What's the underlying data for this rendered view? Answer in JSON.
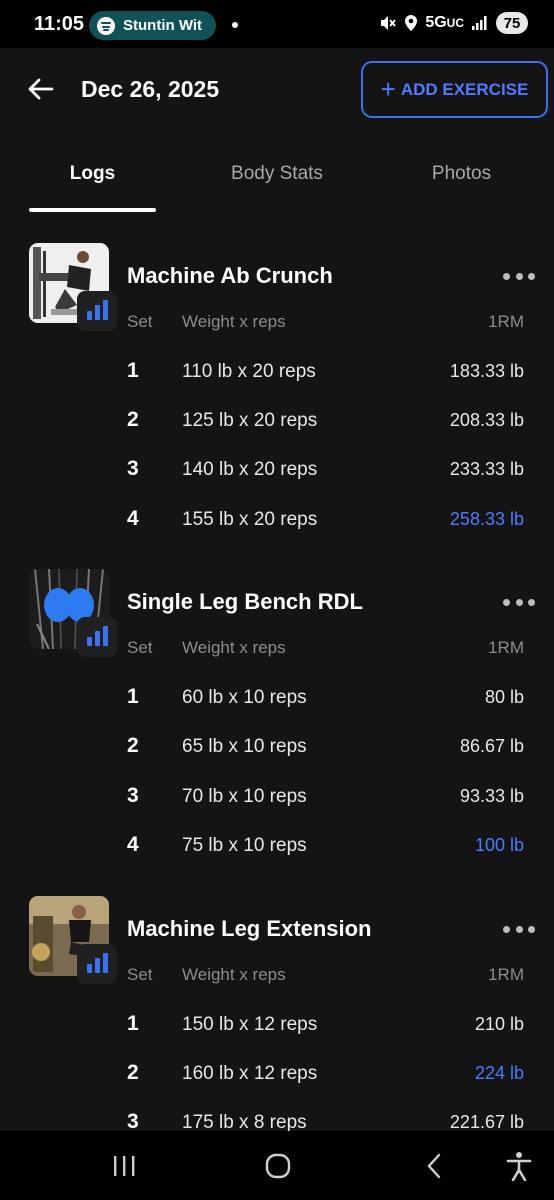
{
  "status_bar": {
    "time": "11:05",
    "media_label": "Stuntin Wit",
    "network": "5G",
    "network_suffix": "UC",
    "battery": "75"
  },
  "header": {
    "date": "Dec 26, 2025",
    "add_button_label": "ADD EXERCISE",
    "add_button_icon": "plus-icon"
  },
  "tabs": [
    {
      "label": "Logs",
      "active": true
    },
    {
      "label": "Body Stats",
      "active": false
    },
    {
      "label": "Photos",
      "active": false
    }
  ],
  "columns": {
    "set": "Set",
    "weight_reps": "Weight x reps",
    "one_rm": "1RM"
  },
  "exercises": [
    {
      "name": "Machine Ab Crunch",
      "sets": [
        {
          "set": "1",
          "weight_reps": "110 lb x 20 reps",
          "one_rm": "183.33 lb",
          "best": false
        },
        {
          "set": "2",
          "weight_reps": "125 lb x 20 reps",
          "one_rm": "208.33 lb",
          "best": false
        },
        {
          "set": "3",
          "weight_reps": "140 lb x 20 reps",
          "one_rm": "233.33 lb",
          "best": false
        },
        {
          "set": "4",
          "weight_reps": "155 lb x 20 reps",
          "one_rm": "258.33 lb",
          "best": true
        }
      ]
    },
    {
      "name": "Single Leg Bench RDL",
      "sets": [
        {
          "set": "1",
          "weight_reps": "60 lb x 10 reps",
          "one_rm": "80 lb",
          "best": false
        },
        {
          "set": "2",
          "weight_reps": "65 lb x 10 reps",
          "one_rm": "86.67 lb",
          "best": false
        },
        {
          "set": "3",
          "weight_reps": "70 lb x 10 reps",
          "one_rm": "93.33 lb",
          "best": false
        },
        {
          "set": "4",
          "weight_reps": "75 lb x 10 reps",
          "one_rm": "100 lb",
          "best": true
        }
      ]
    },
    {
      "name": "Machine Leg Extension",
      "sets": [
        {
          "set": "1",
          "weight_reps": "150 lb x 12 reps",
          "one_rm": "210 lb",
          "best": false
        },
        {
          "set": "2",
          "weight_reps": "160 lb x 12 reps",
          "one_rm": "224 lb",
          "best": true
        },
        {
          "set": "3",
          "weight_reps": "175 lb x 8 reps",
          "one_rm": "221.67 lb",
          "best": false
        }
      ]
    }
  ],
  "colors": {
    "background": "#141414",
    "accent": "#4a7cff",
    "text": "#ffffff",
    "muted": "#8c8c8c"
  },
  "nav_bar": {
    "icons": [
      "recent-apps-icon",
      "home-icon",
      "back-icon",
      "accessibility-icon"
    ]
  }
}
